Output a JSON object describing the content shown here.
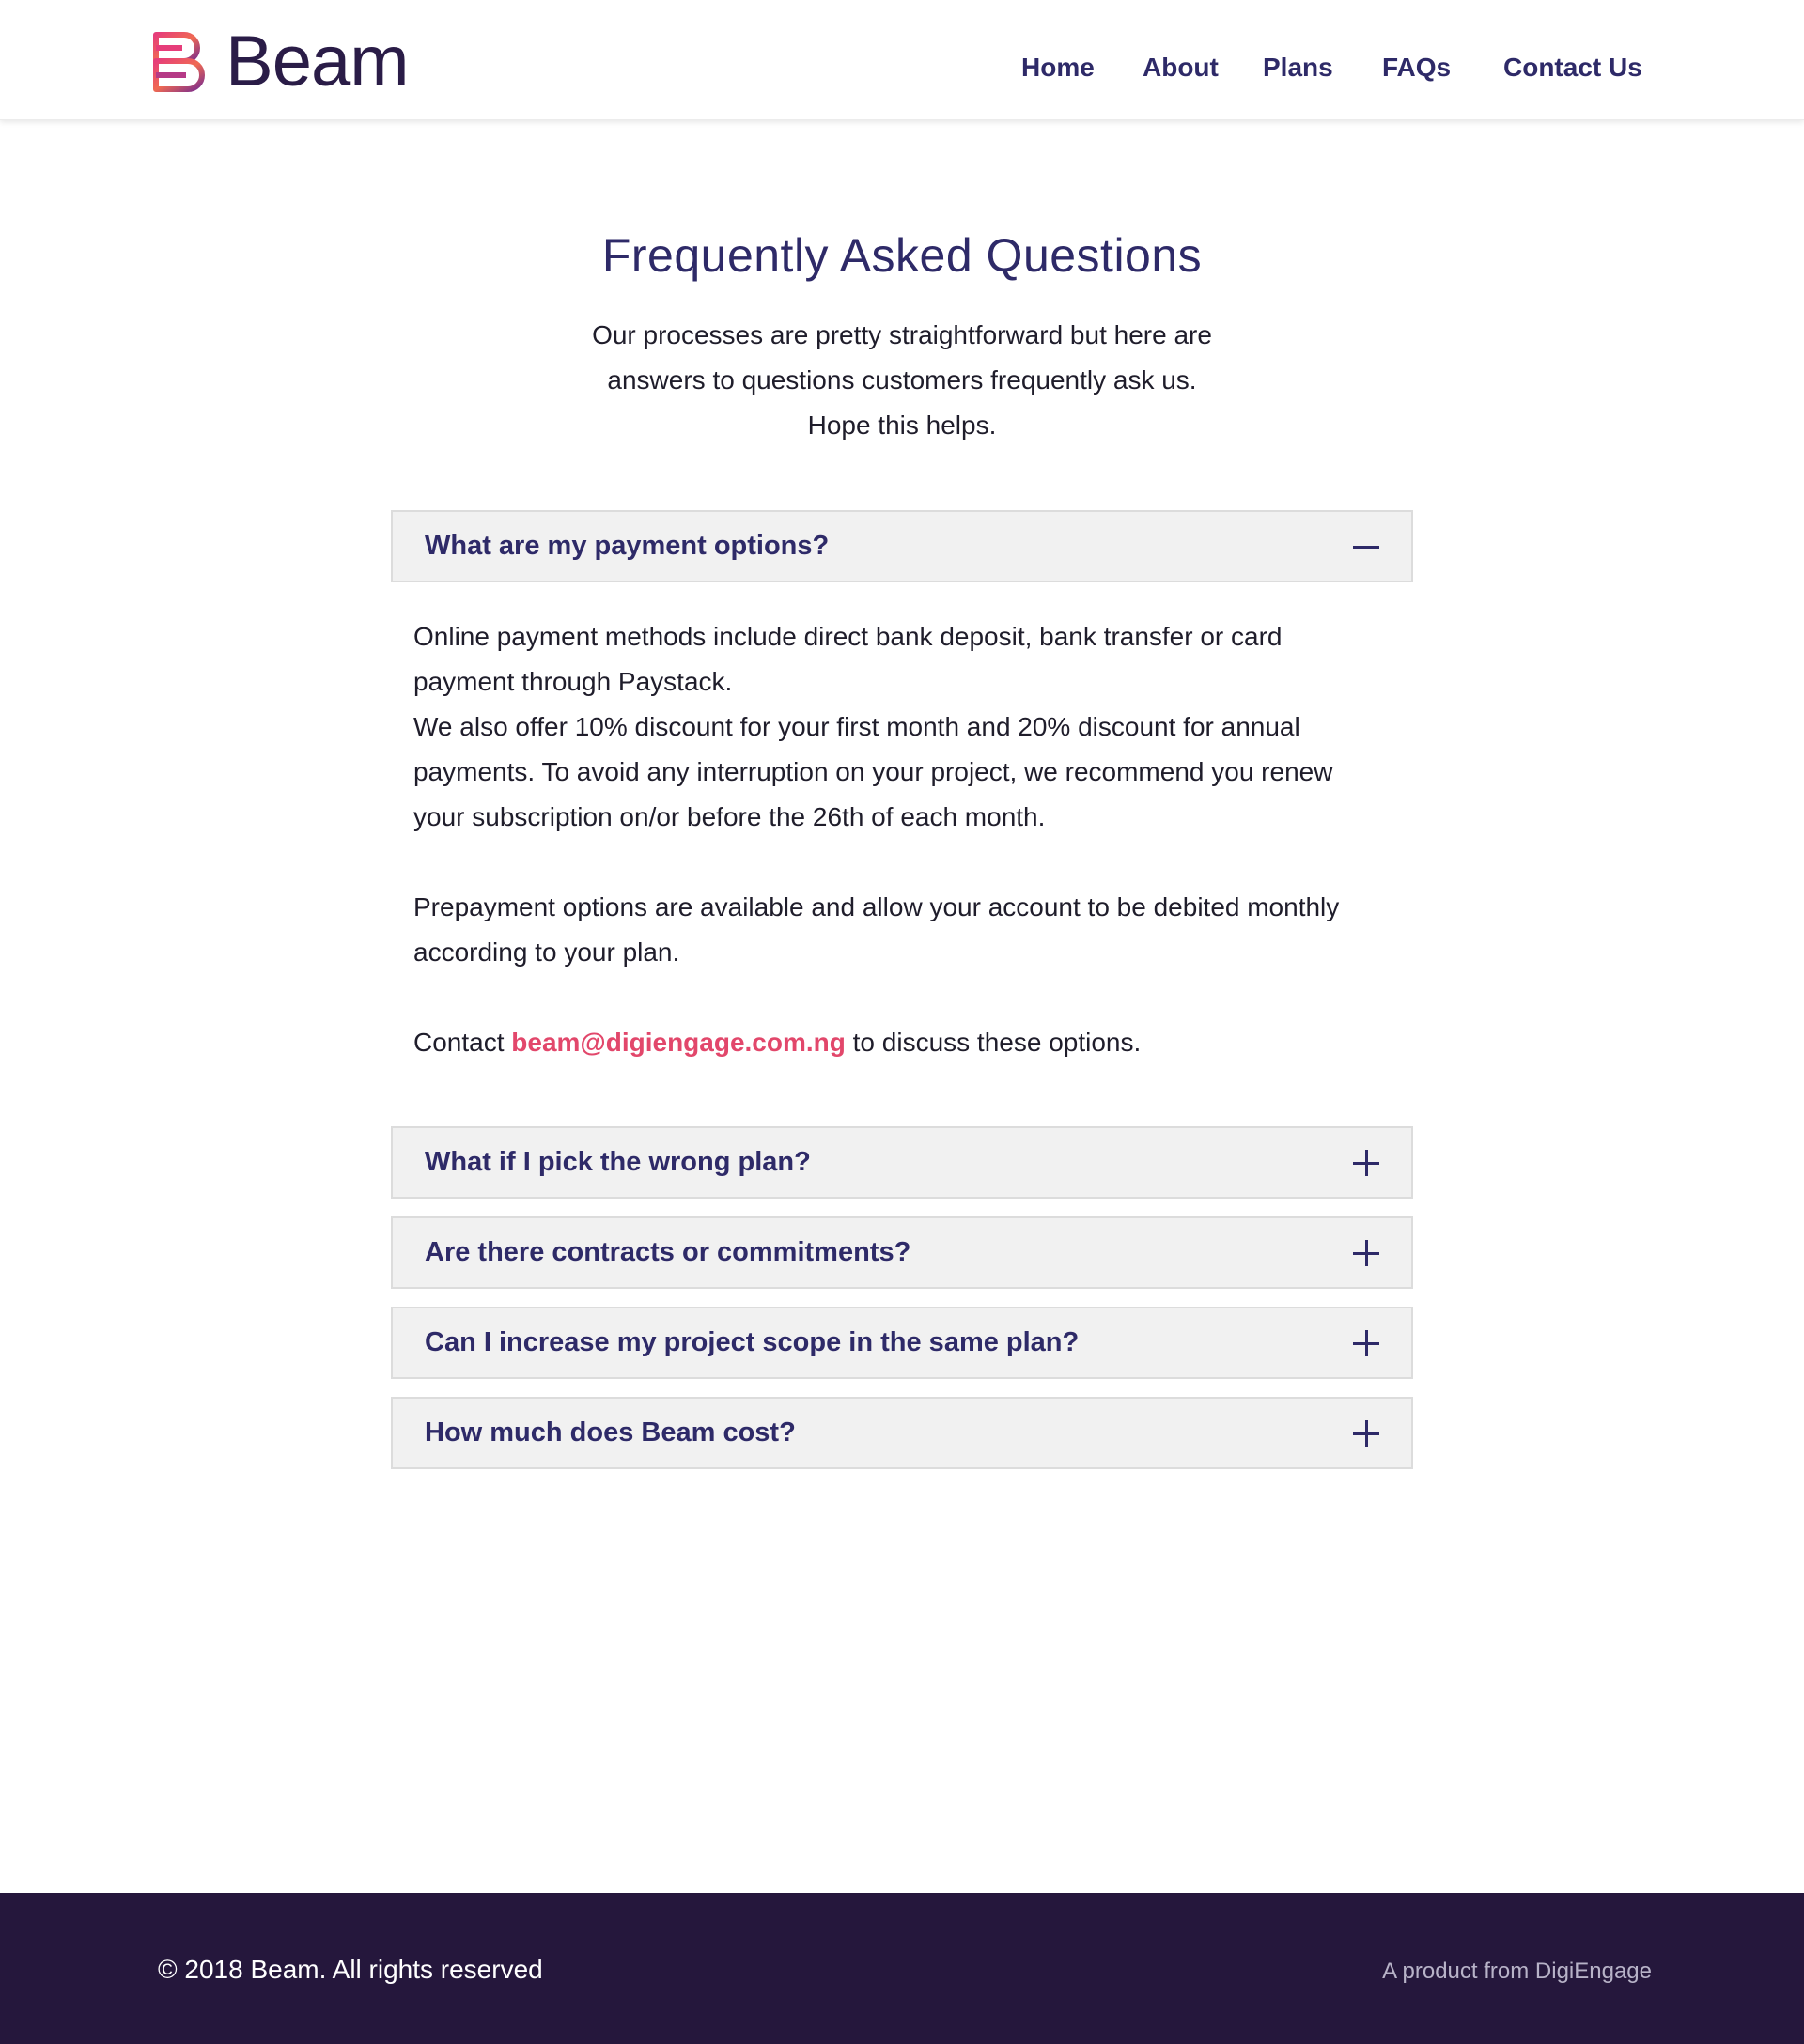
{
  "brand": {
    "name": "Beam"
  },
  "nav": {
    "items": [
      {
        "label": "Home"
      },
      {
        "label": "About"
      },
      {
        "label": "Plans"
      },
      {
        "label": "FAQs"
      },
      {
        "label": "Contact Us"
      }
    ]
  },
  "colors": {
    "primary": "#2e2a68",
    "accent": "#e2476b",
    "footer_bg": "#25173c",
    "question_bg": "#f1f1f1"
  },
  "page": {
    "title": "Frequently Asked Questions",
    "intro_lines": [
      "Our processes are pretty straightforward but here are",
      "answers to questions customers frequently ask us.",
      "Hope this helps."
    ]
  },
  "faqs": [
    {
      "question": "What are my payment options?",
      "expanded": true,
      "icon": "minus-icon",
      "answer": {
        "p1": "Online payment methods include direct bank deposit, bank transfer or card payment through Paystack.",
        "p2": "We also offer 10% discount for your first month and 20% discount for annual payments. To avoid any interruption on your project, we recommend you renew your subscription on/or before the 26th of each month.",
        "p3": "Prepayment options are available and allow your account to be debited monthly according to your plan.",
        "contact_prefix": "Contact ",
        "contact_email": "beam@digiengage.com.ng",
        "contact_suffix": " to discuss these options."
      }
    },
    {
      "question": "What if I pick the wrong plan?",
      "expanded": false,
      "icon": "plus-icon"
    },
    {
      "question": "Are there contracts or commitments?",
      "expanded": false,
      "icon": "plus-icon"
    },
    {
      "question": "Can I increase my project scope in the same plan?",
      "expanded": false,
      "icon": "plus-icon"
    },
    {
      "question": "How much does Beam cost?",
      "expanded": false,
      "icon": "plus-icon"
    }
  ],
  "footer": {
    "copyright": "© 2018 Beam. All rights reserved",
    "credit": "A product from DigiEngage"
  }
}
